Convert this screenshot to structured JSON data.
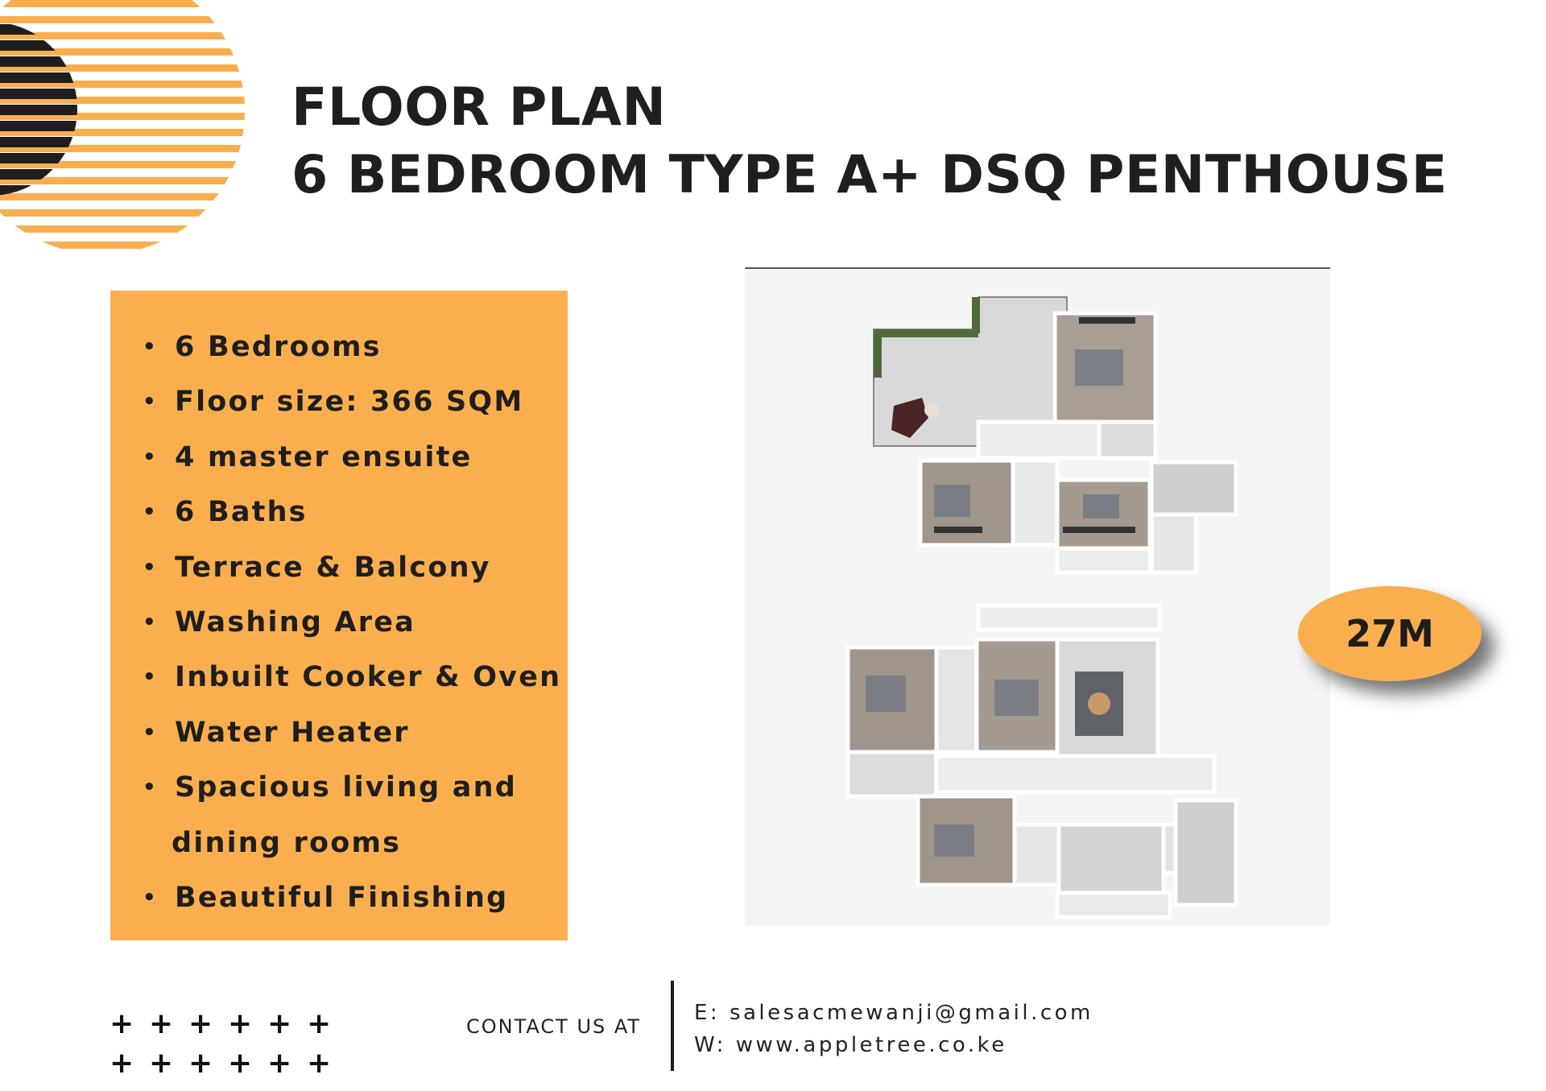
{
  "colors": {
    "accent": "#FBAE4E",
    "dark": "#1e1e1e",
    "background": "#ffffff"
  },
  "header": {
    "title_line1": "FLOOR PLAN",
    "title_line2": "6 BEDROOM TYPE A+ DSQ PENTHOUSE"
  },
  "features": [
    "6 Bedrooms",
    "Floor size: 366 SQM",
    "4 master ensuite",
    "6 Baths",
    "Terrace & Balcony",
    "Washing Area",
    "Inbuilt Cooker & Oven",
    "Water Heater",
    "Spacious living and",
    "dining rooms",
    "Beautiful Finishing"
  ],
  "bullet_glyph": "•",
  "price": {
    "label": "27M"
  },
  "decor": {
    "plus_glyph": "+",
    "plus_count": 12
  },
  "contact": {
    "label": "CONTACT US AT",
    "email": "E: salesacmewanji@gmail.com",
    "website": "W: www.appletree.co.ke"
  }
}
